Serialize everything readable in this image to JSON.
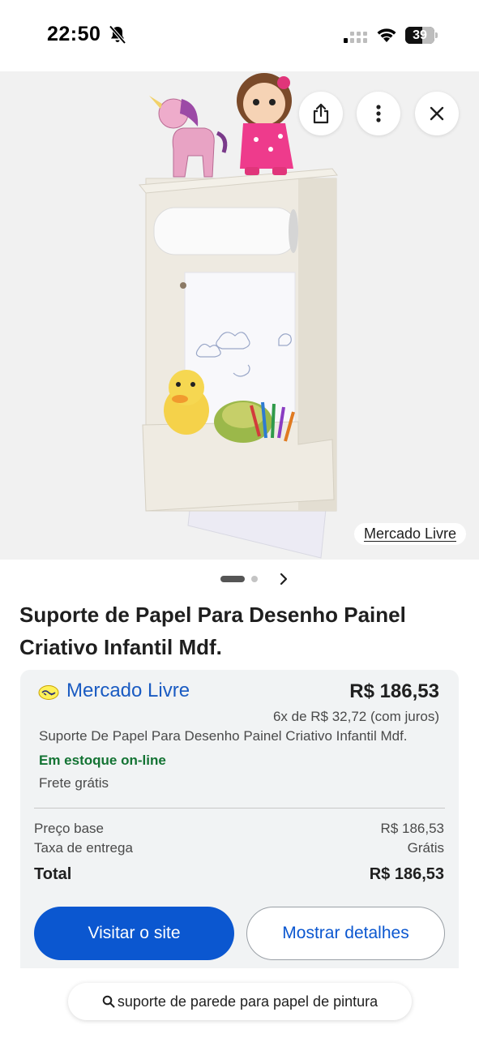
{
  "status_bar": {
    "time": "22:50",
    "battery": "39",
    "battery_level": 0.39,
    "icons": [
      "bell-slash-icon",
      "signal-icon",
      "wifi-icon",
      "battery-icon"
    ]
  },
  "hero": {
    "actions": [
      "share-icon",
      "more-vert-icon",
      "close-icon"
    ],
    "source_label": "Mercado Livre"
  },
  "carousel": {
    "active_index": 0,
    "count": 2
  },
  "product": {
    "title": "Suporte de Papel Para Desenho Painel Criativo Infantil Mdf."
  },
  "offer": {
    "store_name": "Mercado Livre",
    "price": "R$ 186,53",
    "installments": "6x de R$ 32,72 (com juros)",
    "description": "Suporte De Papel Para Desenho Painel Criativo Infantil Mdf.",
    "stock": "Em estoque on-line",
    "shipping": "Frete grátis",
    "base_price_label": "Preço base",
    "base_price_value": "R$ 186,53",
    "delivery_label": "Taxa de entrega",
    "delivery_value": "Grátis",
    "total_label": "Total",
    "total_value": "R$ 186,53",
    "visit_label": "Visitar o site",
    "details_label": "Mostrar detalhes"
  },
  "search": {
    "query": "suporte de parede para papel de pintura"
  },
  "colors": {
    "accent": "#0b57d0",
    "link": "#1a5bc2",
    "stock_green": "#137333",
    "card_bg": "#f1f3f4"
  }
}
